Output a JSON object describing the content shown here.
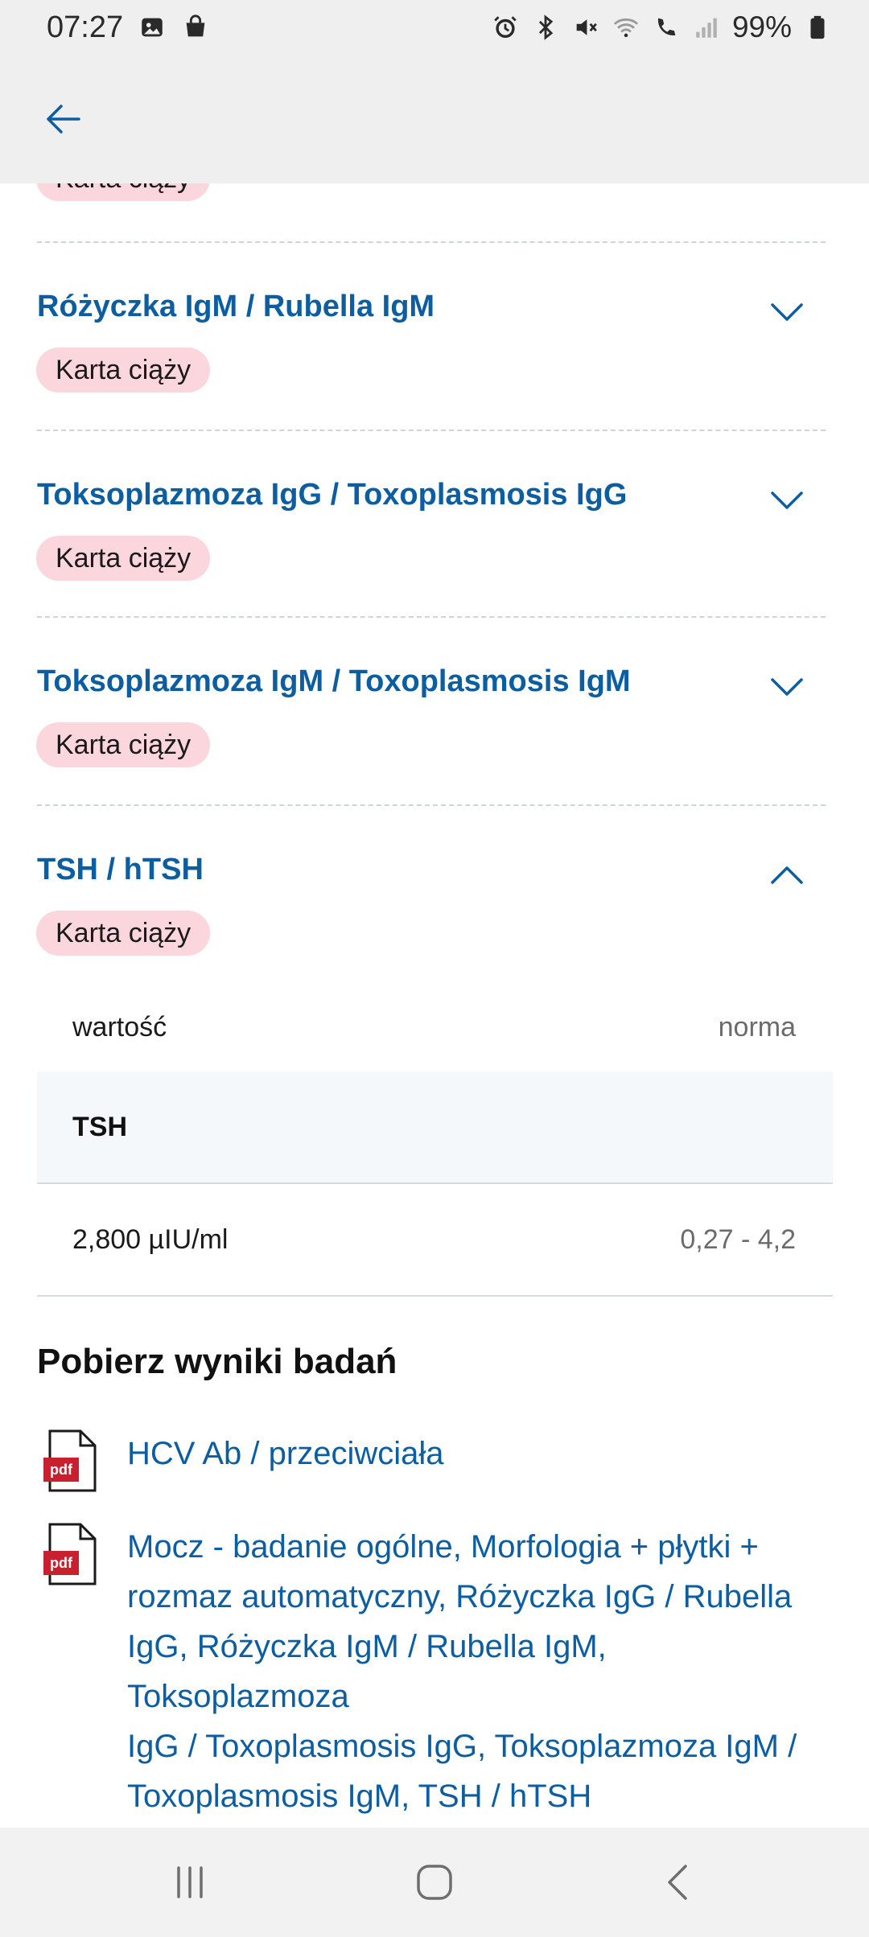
{
  "status_bar": {
    "time": "07:27",
    "battery": "99%",
    "icons_left": [
      "image-icon",
      "shopping-bag-icon"
    ],
    "icons_right": [
      "alarm-icon",
      "bluetooth-icon",
      "mute-icon",
      "wifi-icon",
      "wifi-call-icon",
      "signal-icon",
      "battery-icon"
    ]
  },
  "colors": {
    "accent": "#0d5ea0",
    "badge_bg": "#fbd6dc",
    "appbar_bg": "#efefef",
    "table_group_bg": "#f4f8fb"
  },
  "partial_badge": "Karta ciąży",
  "items": [
    {
      "title": "Różyczka IgM / Rubella IgM",
      "badge": "Karta ciąży",
      "expanded": false
    },
    {
      "title": "Toksoplazmoza IgG / Toxoplasmosis IgG",
      "badge": "Karta ciąży",
      "expanded": false
    },
    {
      "title": "Toksoplazmoza IgM / Toxoplasmosis IgM",
      "badge": "Karta ciąży",
      "expanded": false
    },
    {
      "title": "TSH / hTSH",
      "badge": "Karta ciąży",
      "expanded": true
    }
  ],
  "results_table": {
    "header_value": "wartość",
    "header_norm": "norma",
    "group": "TSH",
    "row_value": "2,800 µIU/ml",
    "row_norm": "0,27 - 4,2"
  },
  "downloads": {
    "title": "Pobierz wyniki badań",
    "links": [
      {
        "icon": "pdf-icon",
        "label_lines": [
          "HCV Ab / przeciwciała"
        ]
      },
      {
        "icon": "pdf-icon",
        "label_lines": [
          "Mocz - badanie ogólne, Morfologia + płytki +",
          "rozmaz automatyczny, Różyczka IgG / Rubella",
          "IgG, Różyczka IgM / Rubella IgM, Toksoplazmoza",
          "IgG / Toxoplasmosis IgG, Toksoplazmoza IgM /",
          "Toxoplasmosis IgM, TSH / hTSH"
        ]
      }
    ]
  },
  "pdf_label": "pdf",
  "navigation": [
    "recents-icon",
    "home-icon",
    "back-icon"
  ]
}
